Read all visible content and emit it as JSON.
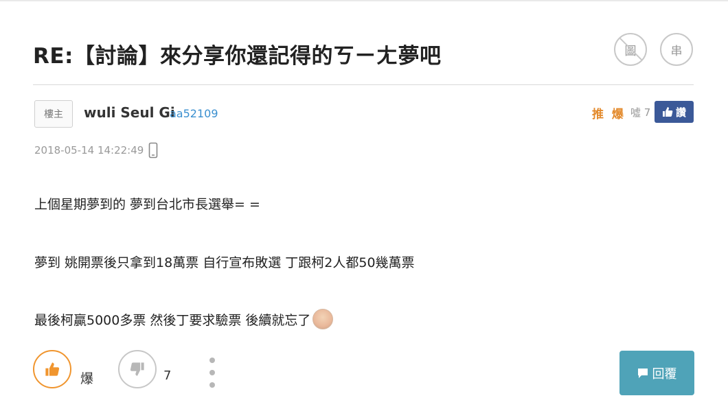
{
  "post": {
    "title": "RE:【討論】來分享你還記得的ㄎㄧㄤ夢吧",
    "owner_tag": "樓主",
    "author_name": "wuli Seul Gi",
    "author_id": "aa52109",
    "timestamp": "2018-05-14 14:22:49",
    "content": [
      "上個星期夢到的  夢到台北市長選舉= =",
      "夢到 姚開票後只拿到18萬票  自行宣布敗選  丁跟柯2人都50幾萬票",
      "最後柯贏5000多票 然後丁要求驗票 後續就忘了"
    ]
  },
  "header_buttons": {
    "picture_label": "圖",
    "thread_label": "串"
  },
  "stats": {
    "push_label": "推 爆",
    "boo_label": "噓 7",
    "fb_label": "讚"
  },
  "actions": {
    "like_label": "爆",
    "dislike_count": "7",
    "reply_label": "回覆"
  },
  "colors": {
    "accent_orange": "#f0952e",
    "link_blue": "#3a8fcf",
    "facebook_blue": "#3b5998",
    "reply_teal": "#4fa3b8"
  },
  "icons": [
    "picture-off-icon",
    "thread-icon",
    "thumbs-up-icon",
    "thumbs-down-icon",
    "mobile-phone-icon",
    "more-vertical-icon",
    "comment-icon",
    "elderly-face-emoji-icon"
  ]
}
